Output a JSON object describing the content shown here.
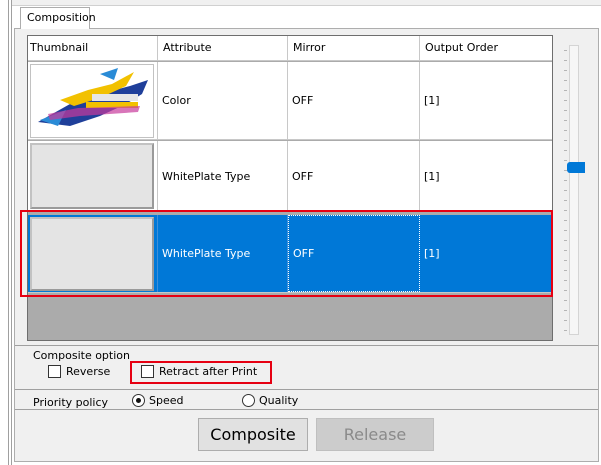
{
  "tab": {
    "label": "Composition"
  },
  "grid": {
    "columns": [
      "Thumbnail",
      "Attribute",
      "Mirror",
      "Output Order"
    ],
    "rows": [
      {
        "attribute": "Color",
        "mirror": "OFF",
        "output_order": "[1]",
        "thumbnail": "color-image-thumbnail",
        "selected": false
      },
      {
        "attribute": "WhitePlate Type",
        "mirror": "OFF",
        "output_order": "[1]",
        "thumbnail": "blank",
        "selected": false
      },
      {
        "attribute": "WhitePlate Type",
        "mirror": "OFF",
        "output_order": "[1]",
        "thumbnail": "blank",
        "selected": true
      }
    ]
  },
  "composite_option": {
    "label": "Composite option",
    "reverse": {
      "label": "Reverse",
      "checked": false
    },
    "retract": {
      "label": "Retract after Print",
      "checked": false
    }
  },
  "priority_policy": {
    "label": "Priority policy",
    "options": [
      {
        "label": "Speed",
        "checked": true
      },
      {
        "label": "Quality",
        "checked": false
      }
    ]
  },
  "buttons": {
    "composite": "Composite",
    "release": "Release"
  },
  "colors": {
    "selection": "#0078d7",
    "highlight": "#e60012"
  }
}
